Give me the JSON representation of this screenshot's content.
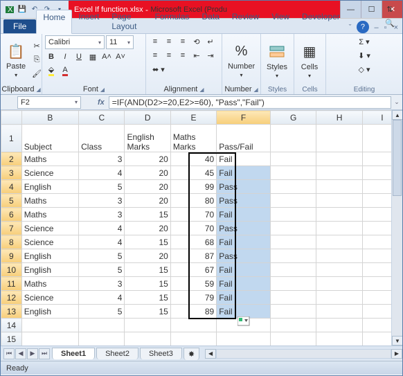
{
  "title": {
    "file": "Excel If function.xlsx",
    "app": "Microsoft Excel (Produ"
  },
  "tabs": {
    "file": "File",
    "list": [
      "Home",
      "Insert",
      "Page Layout",
      "Formulas",
      "Data",
      "Review",
      "View",
      "Developer"
    ],
    "activeIndex": 0
  },
  "ribbon": {
    "clipboard": {
      "label": "Clipboard",
      "paste": "Paste"
    },
    "font": {
      "label": "Font",
      "name": "Calibri",
      "size": "11",
      "bold": "B",
      "italic": "I",
      "underline": "U"
    },
    "alignment": {
      "label": "Alignment"
    },
    "number": {
      "label": "Number",
      "btn": "Number"
    },
    "styles": {
      "label": "Styles",
      "btn": "Styles"
    },
    "cells": {
      "label": "Cells",
      "btn": "Cells"
    },
    "editing": {
      "label": "Editing"
    }
  },
  "namebox": "F2",
  "formula": "=IF(AND(D2>=20,E2>=60), \"Pass\",\"Fail\")",
  "cols": [
    "",
    "B",
    "C",
    "D",
    "E",
    "F",
    "G",
    "H",
    "I"
  ],
  "headerRow": {
    "B": "Subject",
    "C": "Class",
    "D": "English Marks",
    "E": "Maths Marks",
    "F": "Pass/Fail"
  },
  "rows": [
    {
      "n": 2,
      "B": "Maths",
      "C": "3",
      "D": "20",
      "E": "40",
      "F": "Fail"
    },
    {
      "n": 3,
      "B": "Science",
      "C": "4",
      "D": "20",
      "E": "45",
      "F": "Fail"
    },
    {
      "n": 4,
      "B": "English",
      "C": "5",
      "D": "20",
      "E": "99",
      "F": "Pass"
    },
    {
      "n": 5,
      "B": "Maths",
      "C": "3",
      "D": "20",
      "E": "80",
      "F": "Pass"
    },
    {
      "n": 6,
      "B": "Maths",
      "C": "3",
      "D": "15",
      "E": "70",
      "F": "Fail"
    },
    {
      "n": 7,
      "B": "Science",
      "C": "4",
      "D": "20",
      "E": "70",
      "F": "Pass"
    },
    {
      "n": 8,
      "B": "Science",
      "C": "4",
      "D": "15",
      "E": "68",
      "F": "Fail"
    },
    {
      "n": 9,
      "B": "English",
      "C": "5",
      "D": "20",
      "E": "87",
      "F": "Pass"
    },
    {
      "n": 10,
      "B": "English",
      "C": "5",
      "D": "15",
      "E": "67",
      "F": "Fail"
    },
    {
      "n": 11,
      "B": "Maths",
      "C": "3",
      "D": "15",
      "E": "59",
      "F": "Fail"
    },
    {
      "n": 12,
      "B": "Science",
      "C": "4",
      "D": "15",
      "E": "79",
      "F": "Fail"
    },
    {
      "n": 13,
      "B": "English",
      "C": "5",
      "D": "15",
      "E": "89",
      "F": "Fail"
    }
  ],
  "emptyRows": [
    14,
    15
  ],
  "sheets": {
    "list": [
      "Sheet1",
      "Sheet2",
      "Sheet3"
    ],
    "activeIndex": 0
  },
  "status": "Ready"
}
